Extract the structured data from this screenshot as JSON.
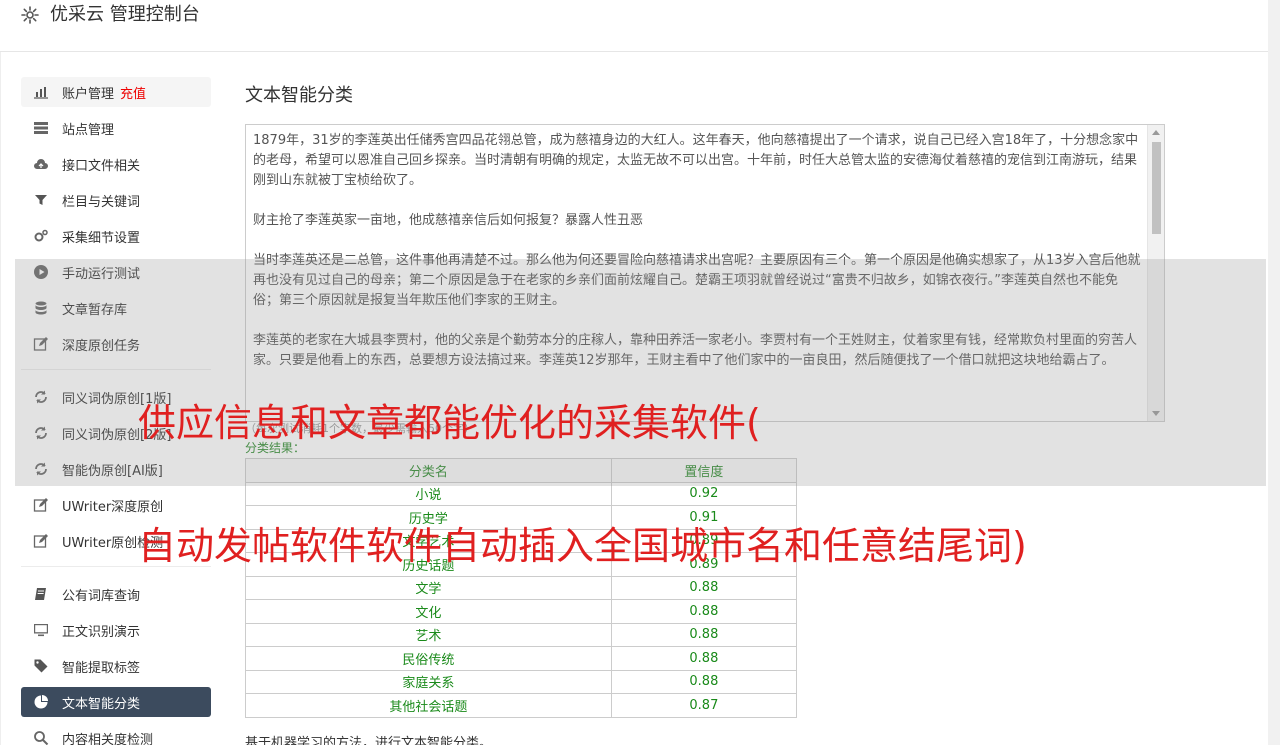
{
  "app": {
    "title": "优采云 管理控制台"
  },
  "sidebar": {
    "group1": [
      {
        "label": "账户管理",
        "extra": "充值",
        "icon": "bar-chart-icon"
      },
      {
        "label": "站点管理",
        "icon": "server-icon"
      },
      {
        "label": "接口文件相关",
        "icon": "cloud-upload-icon"
      },
      {
        "label": "栏目与关键词",
        "icon": "filter-icon"
      },
      {
        "label": "采集细节设置",
        "icon": "gears-icon"
      },
      {
        "label": "手动运行测试",
        "icon": "play-circle-icon"
      },
      {
        "label": "文章暂存库",
        "icon": "database-icon"
      },
      {
        "label": "深度原创任务",
        "icon": "edit-icon"
      }
    ],
    "group2": [
      {
        "label": "同义词伪原创[1版]",
        "icon": "refresh-icon"
      },
      {
        "label": "同义词伪原创[2版]",
        "icon": "refresh-icon"
      },
      {
        "label": "智能伪原创[AI版]",
        "icon": "refresh-icon"
      },
      {
        "label": "UWriter深度原创",
        "icon": "edit-icon"
      },
      {
        "label": "UWriter原创检测",
        "icon": "edit-icon"
      }
    ],
    "group3": [
      {
        "label": "公有词库查询",
        "icon": "book-icon"
      },
      {
        "label": "正文识别演示",
        "icon": "monitor-icon"
      },
      {
        "label": "智能提取标签",
        "icon": "tag-icon"
      },
      {
        "label": "文本智能分类",
        "icon": "pie-chart-icon"
      },
      {
        "label": "内容相关度检测",
        "icon": "search-icon"
      }
    ]
  },
  "main": {
    "heading": "文本智能分类",
    "text_paragraphs": [
      "1879年，31岁的李莲英出任储秀宫四品花翎总管，成为慈禧身边的大红人。这年春天，他向慈禧提出了一个请求，说自己已经入宫18年了，十分想念家中的老母，希望可以恩准自己回乡探亲。当时清朝有明确的规定，太监无故不可以出宫。十年前，时任大总管太监的安德海仗着慈禧的宠信到江南游玩，结果刚到山东就被丁宝桢给砍了。",
      "财主抢了李莲英家一亩地，他成慈禧亲信后如何报复？暴露人性丑恶",
      "当时李莲英还是二总管，这件事他再清楚不过。那么他为何还要冒险向慈禧请求出宫呢？主要原因有三个。第一个原因是他确实想家了，从13岁入宫后他就再也没有见过自己的母亲；第二个原因是急于在老家的乡亲们面前炫耀自己。楚霸王项羽就曾经说过“富贵不归故乡，如锦衣夜行。”李莲英自然也不能免俗；第三个原因就是报复当年欺压他们李家的王财主。",
      "李莲英的老家在大城县李贾村，他的父亲是个勤劳本分的庄稼人，靠种田养活一家老小。李贾村有一个王姓财主，仗着家里有钱，经常欺负村里面的穷苦人家。只要是他看上的东西，总要想方设法搞过来。李莲英12岁那年，王财主看中了他们家中的一亩良田，然后随便找了一个借口就把这块地给霸占了。"
    ],
    "hint": "（每次测试消耗1个字数，最少需输入50个字）",
    "result_label": "分类结果：",
    "table": {
      "headers": [
        "分类名",
        "置信度"
      ],
      "rows": [
        [
          "小说",
          "0.92"
        ],
        [
          "历史学",
          "0.91"
        ],
        [
          "文学艺术",
          "0.89"
        ],
        [
          "历史话题",
          "0.89"
        ],
        [
          "文学",
          "0.88"
        ],
        [
          "文化",
          "0.88"
        ],
        [
          "艺术",
          "0.88"
        ],
        [
          "民俗传统",
          "0.88"
        ],
        [
          "家庭关系",
          "0.88"
        ],
        [
          "其他社会话题",
          "0.87"
        ]
      ]
    },
    "footnote": "基于机器学习的方法，进行文本智能分类。"
  },
  "overlay": {
    "line1": "供应信息和文章都能优化的采集软件(",
    "line2": "自动发帖软件软件自动插入全国城市名和任意结尾词)"
  },
  "colors": {
    "accent": "#3c4b5e",
    "overlay_text": "#e02020",
    "result_green": "#1a8a1a"
  }
}
